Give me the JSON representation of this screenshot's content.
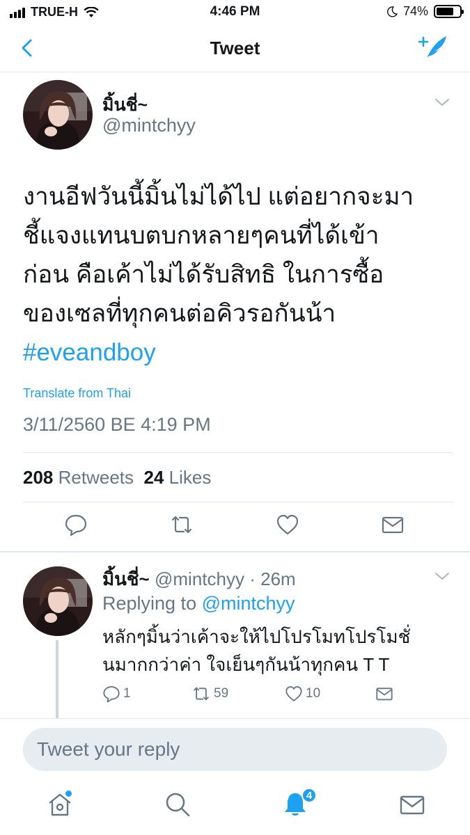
{
  "status_bar": {
    "carrier": "TRUE-H",
    "time": "4:46 PM",
    "battery": "74%",
    "battery_level": 0.74
  },
  "nav": {
    "title": "Tweet",
    "back_icon": "chevron-left-icon",
    "compose_icon": "compose-tweet-icon"
  },
  "tweet": {
    "author_name": "มิ้นชี่~",
    "handle": "@mintchyy",
    "text_lines": [
      "งานอีฟวันนี้มิ้นไม่ได้ไป แต่อยากจะมา",
      "ชี้แจงแทนบตบกหลายๆคนที่ได้เข้า",
      "ก่อน คือเค้าไม่ได้รับสิทธิ ในการซื้อ",
      "ของเซลที่ทุกคนต่อคิวรอกันน้า"
    ],
    "hashtag": "#eveandboy",
    "translate_label": "Translate from Thai",
    "timestamp": "3/11/2560 BE 4:19 PM",
    "retweets_count": "208",
    "retweets_label": "Retweets",
    "likes_count": "24",
    "likes_label": "Likes",
    "actions": [
      "reply-icon",
      "retweet-icon",
      "like-icon",
      "share-icon"
    ]
  },
  "reply": {
    "author_name": "มิ้นชี่~",
    "handle": "@mintchyy",
    "separator": "·",
    "age": "26m",
    "replying_to_label": "Replying to",
    "replying_to_handle": "@mintchyy",
    "text_lines": [
      "หลักๆมิ้นว่าเค้าจะให้ไปโปรโมทโปรโมชั่",
      "นมากกว่าค่า ใจเย็นๆกันน้าทุกคน T T"
    ],
    "reply_count": "1",
    "retweet_count": "59",
    "like_count": "10"
  },
  "composer": {
    "placeholder": "Tweet your reply"
  },
  "tab_bar": {
    "items": [
      "home-icon",
      "search-icon",
      "notifications-icon",
      "messages-icon"
    ],
    "notifications_badge": "4"
  },
  "colors": {
    "accent": "#1da1f2",
    "secondary_text": "#657786",
    "divider": "#e1e8ed"
  }
}
